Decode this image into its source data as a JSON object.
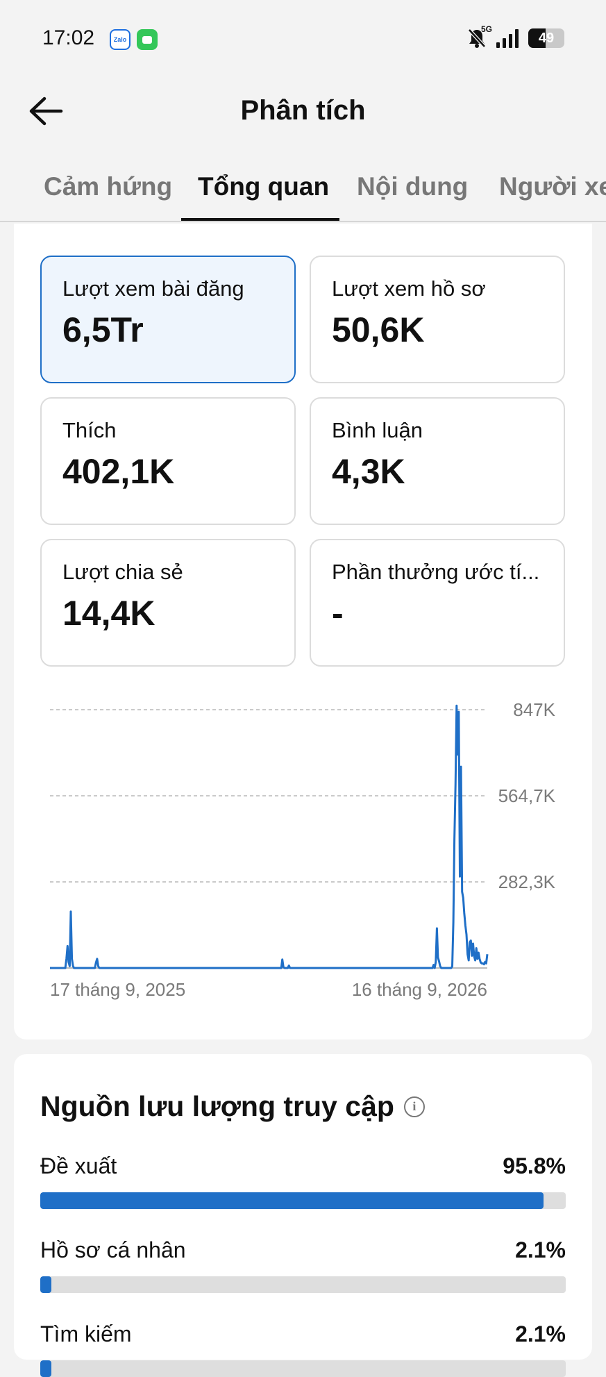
{
  "status_bar": {
    "time": "17:02",
    "apps": [
      "zalo-icon",
      "messages-icon"
    ],
    "zalo_label": "Zalo",
    "network": "5G",
    "battery_level": 49,
    "battery_text": "49"
  },
  "header": {
    "title": "Phân tích",
    "back_icon": "arrow-left-icon"
  },
  "tabs": [
    {
      "label": "Cảm hứng",
      "active": false
    },
    {
      "label": "Tổng quan",
      "active": true
    },
    {
      "label": "Nội dung",
      "active": false
    },
    {
      "label": "Người xe",
      "active": false
    }
  ],
  "metrics": [
    {
      "label": "Lượt xem bài đăng",
      "value": "6,5Tr",
      "selected": true
    },
    {
      "label": "Lượt xem hồ sơ",
      "value": "50,6K",
      "selected": false
    },
    {
      "label": "Thích",
      "value": "402,1K",
      "selected": false
    },
    {
      "label": "Bình luận",
      "value": "4,3K",
      "selected": false
    },
    {
      "label": "Lượt chia sẻ",
      "value": "14,4K",
      "selected": false
    },
    {
      "label": "Phần thưởng ước tí...",
      "value": "-",
      "selected": false
    }
  ],
  "chart_data": {
    "type": "line",
    "series": [
      {
        "values": [
          0,
          0,
          0,
          0,
          0,
          0,
          0,
          0,
          0,
          0,
          0,
          0,
          0,
          0,
          0,
          30000,
          72000,
          20000,
          6000,
          185000,
          30000,
          6000,
          0,
          0,
          0,
          0,
          0,
          0,
          0,
          0,
          0,
          0,
          0,
          0,
          0,
          0,
          0,
          0,
          0,
          0,
          0,
          0,
          18000,
          30000,
          6000,
          0,
          0,
          0,
          0,
          0,
          0,
          0,
          0,
          0,
          0,
          0,
          0,
          0,
          0,
          0,
          0,
          0,
          0,
          0,
          0,
          0,
          0,
          0,
          0,
          0,
          0,
          0,
          0,
          0,
          0,
          0,
          0,
          0,
          0,
          0,
          0,
          0,
          0,
          0,
          0,
          0,
          0,
          0,
          0,
          0,
          0,
          0,
          0,
          0,
          0,
          0,
          0,
          0,
          0,
          0,
          0,
          0,
          0,
          0,
          0,
          0,
          0,
          0,
          0,
          0,
          0,
          0,
          0,
          0,
          0,
          0,
          0,
          0,
          0,
          0,
          0,
          0,
          0,
          0,
          0,
          0,
          0,
          0,
          0,
          0,
          0,
          0,
          0,
          0,
          0,
          0,
          0,
          0,
          0,
          0,
          0,
          0,
          0,
          0,
          0,
          0,
          0,
          0,
          0,
          0,
          0,
          0,
          0,
          0,
          0,
          0,
          0,
          0,
          0,
          0,
          0,
          0,
          0,
          0,
          0,
          0,
          0,
          0,
          0,
          0,
          0,
          0,
          0,
          0,
          0,
          0,
          0,
          0,
          0,
          0,
          0,
          0,
          0,
          0,
          0,
          0,
          0,
          0,
          0,
          0,
          0,
          0,
          0,
          0,
          0,
          0,
          0,
          0,
          0,
          0,
          0,
          0,
          0,
          0,
          0,
          0,
          0,
          0,
          0,
          0,
          0,
          0,
          28000,
          3000,
          0,
          0,
          0,
          0,
          8000,
          0,
          0,
          0,
          0,
          0,
          0,
          0,
          0,
          0,
          0,
          0,
          0,
          0,
          0,
          0,
          0,
          0,
          0,
          0,
          0,
          0,
          0,
          0,
          0,
          0,
          0,
          0,
          0,
          0,
          0,
          0,
          0,
          0,
          0,
          0,
          0,
          0,
          0,
          0,
          0,
          0,
          0,
          0,
          0,
          0,
          0,
          0,
          0,
          0,
          0,
          0,
          0,
          0,
          0,
          0,
          0,
          0,
          0,
          0,
          0,
          0,
          0,
          0,
          0,
          0,
          0,
          0,
          0,
          0,
          0,
          0,
          0,
          0,
          0,
          0,
          0,
          0,
          0,
          0,
          0,
          0,
          0,
          0,
          0,
          0,
          0,
          0,
          0,
          0,
          0,
          0,
          0,
          0,
          0,
          0,
          0,
          0,
          0,
          0,
          0,
          0,
          0,
          0,
          0,
          0,
          0,
          0,
          0,
          0,
          0,
          0,
          0,
          0,
          0,
          0,
          0,
          0,
          0,
          0,
          0,
          0,
          0,
          0,
          0,
          0,
          0,
          0,
          0,
          0,
          0,
          0,
          10000,
          0,
          20000,
          130000,
          35000,
          22000,
          6000,
          0,
          0,
          0,
          0,
          0,
          0,
          0,
          0,
          0,
          0,
          5000,
          150000,
          420000,
          600000,
          860000,
          700000,
          840000,
          300000,
          660000,
          250000,
          230000,
          180000,
          140000,
          110000,
          45000,
          25000,
          85000,
          90000,
          40000,
          80000,
          38000,
          25000,
          65000,
          30000,
          50000,
          30000,
          18000,
          15000,
          15000,
          12000,
          20000,
          15000,
          45000
        ]
      }
    ],
    "x_labels": [
      "17 tháng 9, 2025",
      "16 tháng 9, 2026"
    ],
    "y_ticks": [
      {
        "value": 847000,
        "label": "847K"
      },
      {
        "value": 564700,
        "label": "564,7K"
      },
      {
        "value": 282300,
        "label": "282,3K"
      }
    ],
    "ylim": [
      0,
      847000
    ],
    "grid": true,
    "color": "#1f6fc7"
  },
  "traffic": {
    "title": "Nguồn lưu lượng truy cập",
    "info_icon": "info-icon",
    "sources": [
      {
        "label": "Đề xuất",
        "percent_text": "95.8%",
        "percent": 95.8
      },
      {
        "label": "Hồ sơ cá nhân",
        "percent_text": "2.1%",
        "percent": 2.1
      },
      {
        "label": "Tìm kiếm",
        "percent_text": "2.1%",
        "percent": 2.1
      }
    ]
  },
  "colors": {
    "accent": "#1f6fc7",
    "selected_card_bg": "#eef5fd",
    "track": "#dedede"
  }
}
